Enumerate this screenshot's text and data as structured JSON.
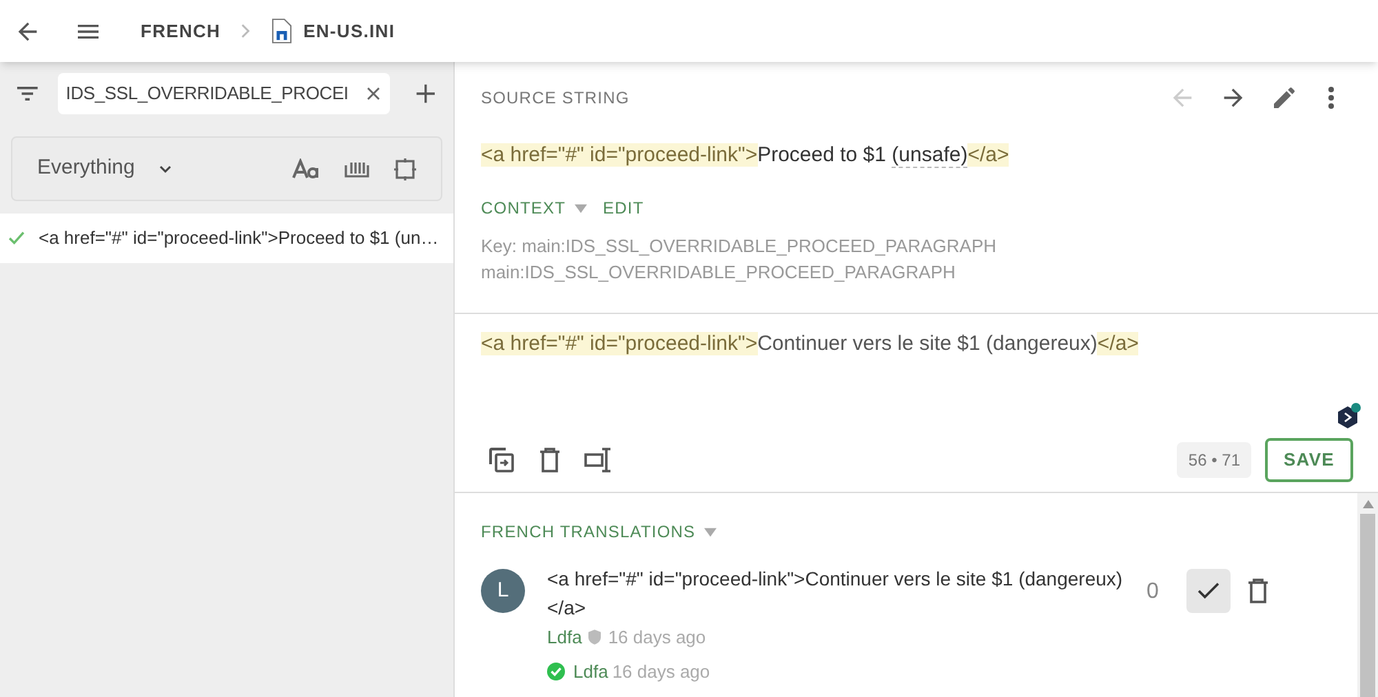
{
  "header": {
    "breadcrumbs": [
      {
        "label": "FRENCH",
        "kind": "locale"
      },
      {
        "label": "EN-US.INI",
        "kind": "file"
      }
    ]
  },
  "sidebar": {
    "search": {
      "value": "IDS_SSL_OVERRIDABLE_PROCEI"
    },
    "filter": {
      "value": "Everything"
    },
    "strings": [
      {
        "text": "<a href=\"#\" id=\"proceed-link\">Proceed to $1 (un…",
        "approved": true,
        "selected": true
      }
    ]
  },
  "source": {
    "title": "SOURCE STRING",
    "segments": [
      {
        "text": "<a href=\"#\" id=\"proceed-link\">",
        "kind": "tag"
      },
      {
        "text": "Proceed to $1 ",
        "kind": "text"
      },
      {
        "text": "(unsafe)",
        "kind": "term"
      },
      {
        "text": "</a>",
        "kind": "tag"
      }
    ],
    "context_label": "CONTEXT",
    "edit_label": "EDIT",
    "context_lines": [
      "Key: main:IDS_SSL_OVERRIDABLE_PROCEED_PARAGRAPH",
      "main:IDS_SSL_OVERRIDABLE_PROCEED_PARAGRAPH"
    ],
    "prev_disabled": true
  },
  "editor": {
    "segments": [
      {
        "text": "<a href=\"#\" id=\"proceed-link\">",
        "kind": "tag"
      },
      {
        "text": "Continuer vers le site $1 (dangereux)",
        "kind": "text"
      },
      {
        "text": "</a>",
        "kind": "tag"
      }
    ],
    "counter": "56 • 71",
    "save_label": "SAVE"
  },
  "translations": {
    "title": "FRENCH TRANSLATIONS",
    "items": [
      {
        "avatar": "L",
        "text": "<a href=\"#\" id=\"proceed-link\">Continuer vers le site $1 (dangereux) </a>",
        "author": "Ldfa",
        "time": "16 days ago",
        "approver": "Ldfa",
        "approved_time": "16 days ago",
        "votes": "0",
        "approved": true
      }
    ]
  }
}
